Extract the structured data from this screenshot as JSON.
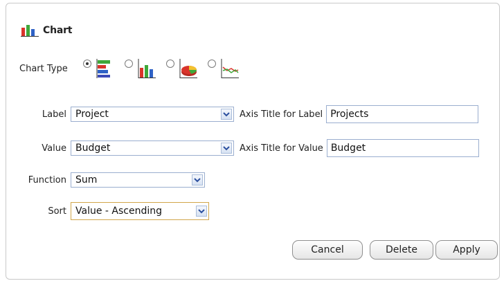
{
  "header": {
    "title": "Chart",
    "icon": "bar-chart-icon"
  },
  "chart_type": {
    "label": "Chart Type",
    "selected": "horizontal-bar",
    "options": [
      {
        "icon": "horizontal-bar-chart-icon",
        "checked": true
      },
      {
        "icon": "vertical-bar-chart-icon",
        "checked": false
      },
      {
        "icon": "pie-chart-icon",
        "checked": false
      },
      {
        "icon": "line-chart-icon",
        "checked": false
      }
    ]
  },
  "fields": {
    "label": {
      "label": "Label",
      "value": "Project"
    },
    "axis_title_label": {
      "label": "Axis Title for Label",
      "value": "Projects"
    },
    "value": {
      "label": "Value",
      "value": "Budget"
    },
    "axis_title_value": {
      "label": "Axis Title for Value",
      "value": "Budget"
    },
    "function": {
      "label": "Function",
      "value": "Sum"
    },
    "sort": {
      "label": "Sort",
      "value": "Value - Ascending"
    }
  },
  "buttons": {
    "cancel": "Cancel",
    "delete": "Delete",
    "apply": "Apply"
  },
  "colors": {
    "select_border": "#9aaecf",
    "focus_border": "#d1a64a",
    "arrow_blue": "#2b4f9e"
  }
}
